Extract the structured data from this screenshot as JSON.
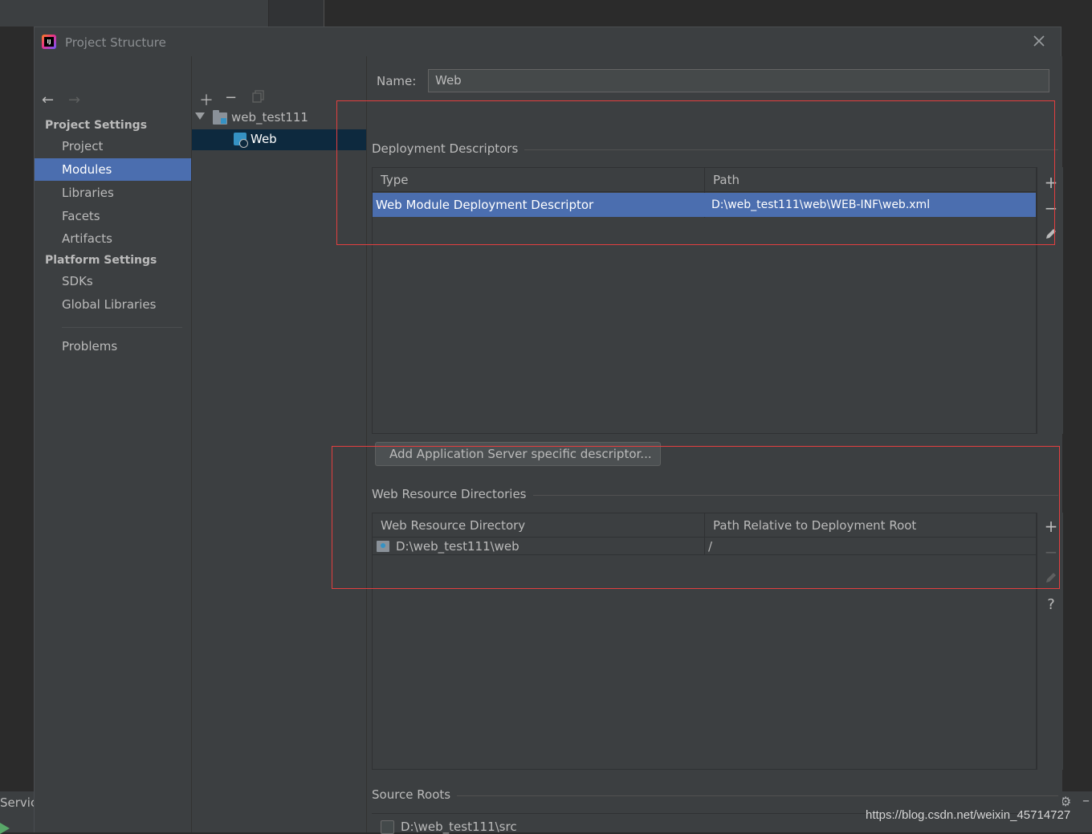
{
  "background": {
    "bottom_tool_label": "Servic",
    "watermark": "https://blog.csdn.net/weixin_45714727"
  },
  "dialog": {
    "title": "Project Structure",
    "logo_text": "IJ",
    "close_icon": "close-icon"
  },
  "nav": {
    "back_icon": "arrow-left-icon",
    "forward_icon": "arrow-right-icon",
    "project_settings_header": "Project Settings",
    "project_settings": [
      "Project",
      "Modules",
      "Libraries",
      "Facets",
      "Artifacts"
    ],
    "platform_settings_header": "Platform Settings",
    "platform_settings": [
      "SDKs",
      "Global Libraries"
    ],
    "problems": "Problems",
    "selected": "Modules"
  },
  "tree": {
    "toolbar": [
      "add-icon",
      "remove-icon",
      "copy-icon"
    ],
    "root_label": "web_test111",
    "child_label": "Web"
  },
  "panel": {
    "name_label": "Name:",
    "name_value": "Web",
    "deployment": {
      "title": "Deployment Descriptors",
      "columns": [
        "Type",
        "Path"
      ],
      "rows": [
        {
          "type": "Web Module Deployment Descriptor",
          "path": "D:\\web_test111\\web\\WEB-INF\\web.xml"
        }
      ]
    },
    "add_server_button": "Add Application Server specific descriptor...",
    "web_resources": {
      "title": "Web Resource Directories",
      "columns": [
        "Web Resource Directory",
        "Path Relative to Deployment Root"
      ],
      "rows": [
        {
          "directory": "D:\\web_test111\\web",
          "relative": "/"
        }
      ],
      "help_label": "?"
    },
    "source_roots": {
      "title": "Source Roots",
      "items": [
        {
          "path": "D:\\web_test111\\src",
          "checked": false
        }
      ]
    }
  },
  "colors": {
    "selection": "#4b6eaf",
    "annotation_red": "#e33f3f",
    "dialog_bg": "#3c3f41"
  }
}
